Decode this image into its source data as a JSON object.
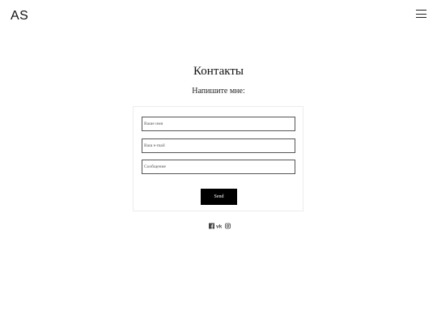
{
  "header": {
    "logo": "AS",
    "menu_icon": "hamburger-menu-icon"
  },
  "contact": {
    "title": "Контакты",
    "subtitle": "Напишите мне:"
  },
  "form": {
    "name_placeholder": "Ваше имя",
    "email_placeholder": "Ваш e-mail",
    "message_placeholder": "Сообщение",
    "send_label": "Send"
  },
  "social": {
    "icons": [
      "facebook-icon",
      "vk-icon",
      "instagram-icon"
    ],
    "vk_text": "vk"
  }
}
